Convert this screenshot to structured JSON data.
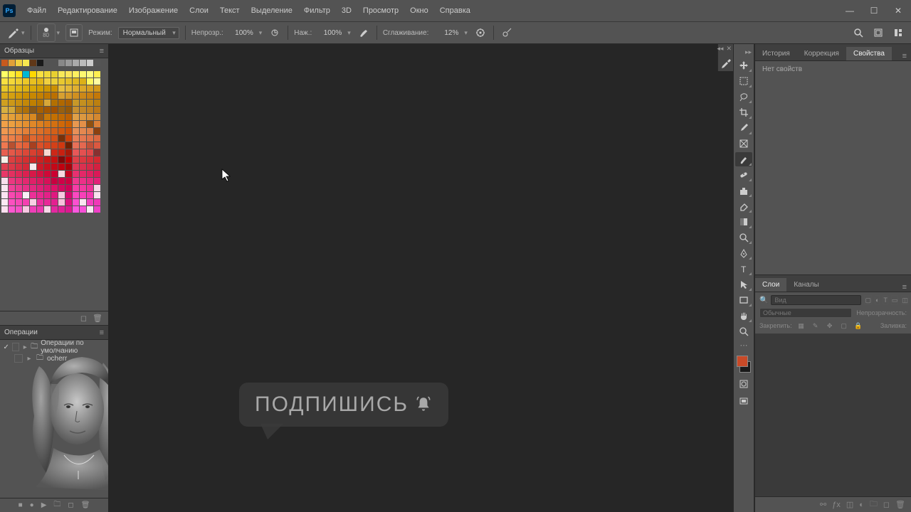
{
  "menu": {
    "items": [
      "Файл",
      "Редактирование",
      "Изображение",
      "Слои",
      "Текст",
      "Выделение",
      "Фильтр",
      "3D",
      "Просмотр",
      "Окно",
      "Справка"
    ]
  },
  "appLogo": "Ps",
  "options": {
    "brushSize": "80",
    "modeLabel": "Режим:",
    "modeValue": "Нормальный",
    "opacityLabel": "Непрозр.:",
    "opacityValue": "100%",
    "flowLabel": "Наж.:",
    "flowValue": "100%",
    "smoothLabel": "Сглаживание:",
    "smoothValue": "12%"
  },
  "panels": {
    "swatches": "Образцы",
    "actions": "Операции",
    "history": "История",
    "corrections": "Коррекция",
    "properties": "Свойства",
    "propsEmpty": "Нет свойств",
    "layers": "Слои",
    "channels": "Каналы"
  },
  "actions": {
    "default": "Операции по умолчанию",
    "user": "ocherr"
  },
  "layers": {
    "searchPlaceholder": "Вид",
    "blend": "Обычные",
    "opacityLabel": "Непрозрачность:",
    "lockLabel": "Закрепить:",
    "fillLabel": "Заливка:"
  },
  "bubble": {
    "text": "ПОДПИШИСЬ"
  },
  "swatchGrid": {
    "topRow": [
      "#c85a1e",
      "#e0a038",
      "#f0d040",
      "#f8e850",
      "#603818",
      "#1a1a1a",
      "",
      "",
      "#888",
      "#999",
      "#aaa",
      "#bbb",
      "#ccc",
      "#555"
    ],
    "rows": [
      [
        "#ffff66",
        "#fff040",
        "#ffe020",
        "#00b8d4",
        "#ffd800",
        "#f8e040",
        "#f0d838",
        "#e8d030",
        "#f8e858",
        "#fce45a",
        "#fff060",
        "#fff870",
        "#fffc80",
        "#ffee50"
      ],
      [
        "#f8e040",
        "#f4d838",
        "#f0d030",
        "#ecc828",
        "#e8c020",
        "#e4b818",
        "#f0d040",
        "#ecd038",
        "#e8c830",
        "#e4c028",
        "#e0b820",
        "#dcb018",
        "#fff860",
        "#fffca0"
      ],
      [
        "#e8c828",
        "#e4c020",
        "#e0b818",
        "#dcb010",
        "#d8a808",
        "#d4a000",
        "#d09800",
        "#cc9000",
        "#e8c040",
        "#e4b838",
        "#e0b030",
        "#dca828",
        "#d8a020",
        "#d49818"
      ],
      [
        "#d8a818",
        "#d4a010",
        "#d09808",
        "#cc9000",
        "#c88800",
        "#c48000",
        "#c07800",
        "#bc7000",
        "#d8a030",
        "#d49828",
        "#d09020",
        "#cc8818",
        "#c88010",
        "#c47808"
      ],
      [
        "#d0a020",
        "#cc9818",
        "#c89010",
        "#c48808",
        "#c08000",
        "#b87800",
        "#d8a838",
        "#b47000",
        "#b06800",
        "#ac6000",
        "#c89828",
        "#c49020",
        "#c08818",
        "#bc8010"
      ],
      [
        "#d8b040",
        "#d4a838",
        "#b47810",
        "#b07008",
        "#885818",
        "#a86000",
        "#a45800",
        "#a05000",
        "#986010",
        "#945808",
        "#c89030",
        "#c48828",
        "#c08020",
        "#bc7818"
      ],
      [
        "#e8a840",
        "#e4a038",
        "#e09830",
        "#dc9028",
        "#d88820",
        "#985810",
        "#c87808",
        "#c47000",
        "#c06800",
        "#bc6000",
        "#e0a048",
        "#dc9840",
        "#d89038",
        "#d48830"
      ],
      [
        "#f0a048",
        "#eca040",
        "#e89838",
        "#e49030",
        "#e08828",
        "#dc8020",
        "#d87818",
        "#d47010",
        "#d06808",
        "#cc6000",
        "#e89850",
        "#e49048",
        "#905010",
        "#dc8038"
      ],
      [
        "#f09850",
        "#ec9048",
        "#e88840",
        "#e48038",
        "#e07830",
        "#dc7028",
        "#d86820",
        "#d46018",
        "#d05810",
        "#cc5008",
        "#e89058",
        "#e48850",
        "#e08048",
        "#8c4010"
      ],
      [
        "#f08850",
        "#ec8048",
        "#e87840",
        "#cc5820",
        "#e06830",
        "#dc6028",
        "#d85820",
        "#d45018",
        "#783008",
        "#cc4008",
        "#e88058",
        "#e47850",
        "#e07048",
        "#dc6840"
      ],
      [
        "#f07850",
        "#b85030",
        "#e86840",
        "#e46038",
        "#a84020",
        "#dc5028",
        "#d84820",
        "#d44018",
        "#d03810",
        "#702000",
        "#e87058",
        "#e46850",
        "#c05038",
        "#dc5840"
      ],
      [
        "#e86050",
        "#e45848",
        "#e05040",
        "#dc4838",
        "#d84030",
        "#d43828",
        "#f8d8d0",
        "#cc2818",
        "#c82010",
        "#a81808",
        "#e85858",
        "#e45050",
        "#e04848",
        "#883030"
      ],
      [
        "#f8f0e8",
        "#dc4040",
        "#d83838",
        "#d43030",
        "#d02828",
        "#cc2020",
        "#c81818",
        "#c41010",
        "#800808",
        "#bc0000",
        "#e04048",
        "#dc3840",
        "#d83038",
        "#d42830"
      ],
      [
        "#e04050",
        "#dc3848",
        "#d83040",
        "#d42838",
        "#f8e8ec",
        "#cc1828",
        "#c81020",
        "#c40818",
        "#c00010",
        "#a80008",
        "#e03858",
        "#dc3050",
        "#d82848",
        "#d42040"
      ],
      [
        "#e83868",
        "#e43060",
        "#e02858",
        "#dc2050",
        "#d81848",
        "#d41040",
        "#d00838",
        "#cc0030",
        "#f8d8e0",
        "#c40020",
        "#e83070",
        "#e42868",
        "#e02060",
        "#dc1858"
      ],
      [
        "#f8e0ec",
        "#ec3880",
        "#e83078",
        "#e42870",
        "#e02068",
        "#dc1860",
        "#d81058",
        "#c80040",
        "#d00048",
        "#cc0040",
        "#f03890",
        "#ec3088",
        "#e82880",
        "#e42078"
      ],
      [
        "#f8e8f0",
        "#f04098",
        "#ec3890",
        "#e83088",
        "#e42880",
        "#e02078",
        "#dc1870",
        "#e01068",
        "#d40860",
        "#d00058",
        "#f83ca8",
        "#f438a0",
        "#f03098",
        "#f8d8e8"
      ],
      [
        "#fce4f2",
        "#f848b0",
        "#f440a8",
        "#f8f0f6",
        "#ec3098",
        "#e82890",
        "#e42088",
        "#e01880",
        "#f8c8e0",
        "#d80870",
        "#fc48c0",
        "#f840b8",
        "#f438b0",
        "#f8e0ee"
      ],
      [
        "#fce8f4",
        "#fc50c0",
        "#f848b8",
        "#f440b0",
        "#f8d0e4",
        "#ec30a0",
        "#e82898",
        "#e42090",
        "#f8c0dc",
        "#dc1080",
        "#fc50d0",
        "#fae4f0",
        "#f440c0",
        "#f038b8"
      ],
      [
        "#fce0f0",
        "#fc58d0",
        "#f850c8",
        "#f8c8e2",
        "#f040b8",
        "#ec38b0",
        "#f8d8e8",
        "#e428a0",
        "#e02098",
        "#dc1890",
        "#fc58e0",
        "#f850d8",
        "#f8e8f2",
        "#f040c8"
      ]
    ]
  }
}
